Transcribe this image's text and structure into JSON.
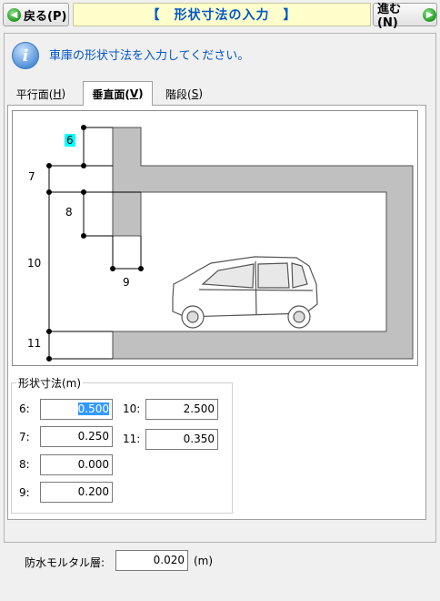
{
  "nav": {
    "back_label": "戻る(P)",
    "next_label": "進む(N)",
    "title": "【　形状寸法の入力　】"
  },
  "instruction": "車庫の形状寸法を入力してください。",
  "tabs": [
    {
      "label": "平行面(",
      "key": "H",
      "active": false
    },
    {
      "label": "垂直面(",
      "key": "V",
      "active": true
    },
    {
      "label": "階段(",
      "key": "S",
      "active": false
    }
  ],
  "diagram": {
    "labels": {
      "d6": "6",
      "d7": "7",
      "d8": "8",
      "d9": "9",
      "d10": "10",
      "d11": "11"
    }
  },
  "dims": {
    "group_label": "形状寸法(m)",
    "f6": {
      "label": "6:",
      "value": "0.500"
    },
    "f7": {
      "label": "7:",
      "value": "0.250"
    },
    "f8": {
      "label": "8:",
      "value": "0.000"
    },
    "f9": {
      "label": "9:",
      "value": "0.200"
    },
    "f10": {
      "label": "10:",
      "value": "2.500"
    },
    "f11": {
      "label": "11:",
      "value": "0.350"
    }
  },
  "mortar": {
    "label": "防水モルタル層:",
    "value": "0.020",
    "unit": "(m)"
  },
  "colors": {
    "title_bg": "#ffffcc",
    "title_text": "#0055c8",
    "wall": "#c0c0c0",
    "highlight": "#00ffff",
    "selection": "#3399ff"
  },
  "icons": {
    "back": "arrow-left-circle-icon",
    "next": "arrow-right-circle-icon",
    "info": "info-icon",
    "car": "car-icon"
  }
}
